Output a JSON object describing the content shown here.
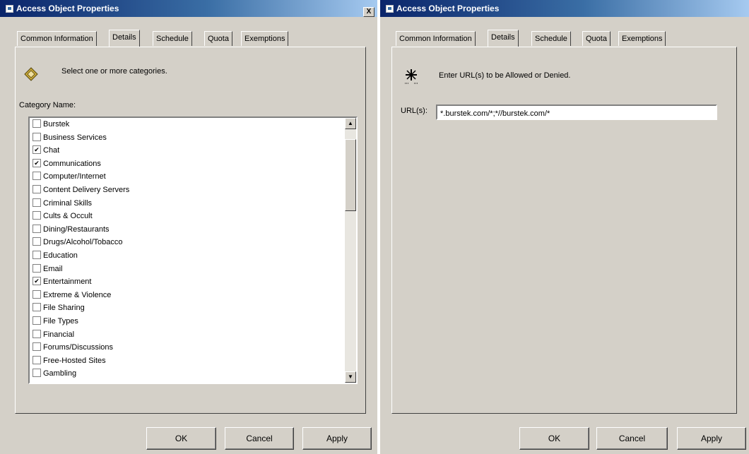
{
  "left_window": {
    "title": "Access Object Properties",
    "close_label": "X",
    "tabs": [
      "Common Information",
      "Details",
      "Schedule",
      "Quota",
      "Exemptions"
    ],
    "active_tab": "Details",
    "instruction": "Select one or more categories.",
    "list_header": "Category Name:",
    "categories": [
      {
        "label": "Burstek",
        "checked": false
      },
      {
        "label": "Business Services",
        "checked": false
      },
      {
        "label": "Chat",
        "checked": true
      },
      {
        "label": "Communications",
        "checked": true
      },
      {
        "label": "Computer/Internet",
        "checked": false
      },
      {
        "label": "Content Delivery Servers",
        "checked": false
      },
      {
        "label": "Criminal Skills",
        "checked": false
      },
      {
        "label": "Cults & Occult",
        "checked": false
      },
      {
        "label": "Dining/Restaurants",
        "checked": false
      },
      {
        "label": "Drugs/Alcohol/Tobacco",
        "checked": false
      },
      {
        "label": "Education",
        "checked": false
      },
      {
        "label": "Email",
        "checked": false
      },
      {
        "label": "Entertainment",
        "checked": true
      },
      {
        "label": "Extreme & Violence",
        "checked": false
      },
      {
        "label": "File Sharing",
        "checked": false
      },
      {
        "label": "File Types",
        "checked": false
      },
      {
        "label": "Financial",
        "checked": false
      },
      {
        "label": "Forums/Discussions",
        "checked": false
      },
      {
        "label": "Free-Hosted Sites",
        "checked": false
      },
      {
        "label": "Gambling",
        "checked": false
      }
    ],
    "buttons": {
      "ok": "OK",
      "cancel": "Cancel",
      "apply": "Apply"
    }
  },
  "right_window": {
    "title": "Access Object Properties",
    "tabs": [
      "Common Information",
      "Details",
      "Schedule",
      "Quota",
      "Exemptions"
    ],
    "active_tab": "Details",
    "instruction": "Enter URL(s) to be Allowed or Denied.",
    "url_label": "URL(s):",
    "url_value": "*.burstek.com/*;*//burstek.com/*",
    "buttons": {
      "ok": "OK",
      "cancel": "Cancel",
      "apply": "Apply"
    }
  },
  "icons": {
    "titlebar": "window-icon",
    "category": "category-icon",
    "url": "asterisk-icon",
    "check": "✔",
    "scroll_up": "▲",
    "scroll_down": "▼"
  }
}
